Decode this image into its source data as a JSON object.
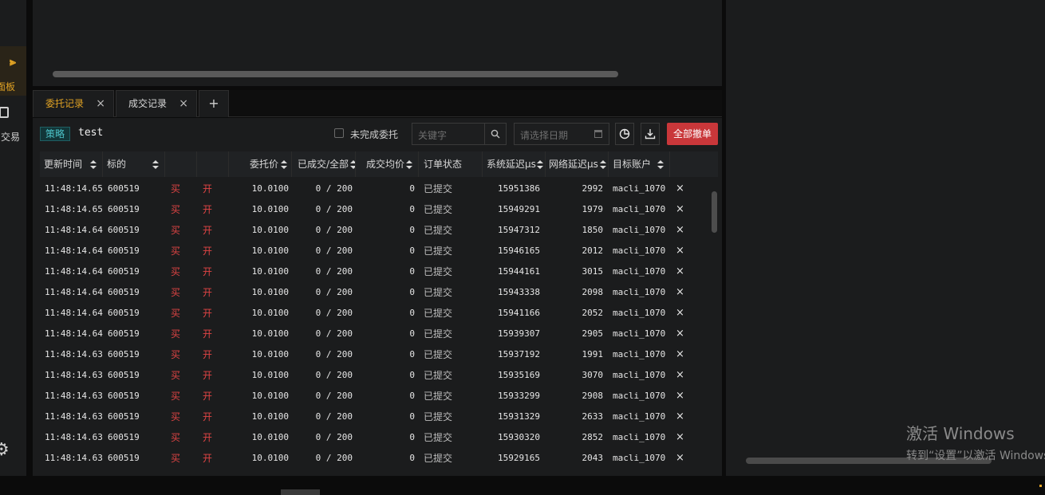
{
  "sidebar": {
    "active_label": "面板",
    "active_icon": "panel-icon",
    "trade_label": "交易",
    "trade_icon": "bag-icon",
    "settings_icon": "gear-icon"
  },
  "tabs": [
    {
      "label": "委托记录",
      "active": true
    },
    {
      "label": "成交记录",
      "active": false
    }
  ],
  "tab_close": "×",
  "tab_add": "+",
  "toolbar": {
    "strategy_tag": "策略",
    "strategy_name": "test",
    "unfinished_label": "未完成委托",
    "keyword_placeholder": "关键字",
    "date_placeholder": "请选择日期",
    "cancel_all_label": "全部撤单"
  },
  "columns": [
    "更新时间",
    "标的",
    "",
    "",
    "委托价",
    "已成交/全部",
    "成交均价",
    "订单状态",
    "系统延迟μs",
    "网络延迟μs",
    "目标账户",
    ""
  ],
  "rows": [
    {
      "time": "11:48:14.65",
      "symbol": "600519",
      "side": "买",
      "offset": "开",
      "price": "10.0100",
      "filled": "0 / 200",
      "avg": "0",
      "status": "已提交",
      "sys_latency": "15951386",
      "net_latency": "2992",
      "account": "macli_1070"
    },
    {
      "time": "11:48:14.65",
      "symbol": "600519",
      "side": "买",
      "offset": "开",
      "price": "10.0100",
      "filled": "0 / 200",
      "avg": "0",
      "status": "已提交",
      "sys_latency": "15949291",
      "net_latency": "1979",
      "account": "macli_1070"
    },
    {
      "time": "11:48:14.64",
      "symbol": "600519",
      "side": "买",
      "offset": "开",
      "price": "10.0100",
      "filled": "0 / 200",
      "avg": "0",
      "status": "已提交",
      "sys_latency": "15947312",
      "net_latency": "1850",
      "account": "macli_1070"
    },
    {
      "time": "11:48:14.64",
      "symbol": "600519",
      "side": "买",
      "offset": "开",
      "price": "10.0100",
      "filled": "0 / 200",
      "avg": "0",
      "status": "已提交",
      "sys_latency": "15946165",
      "net_latency": "2012",
      "account": "macli_1070"
    },
    {
      "time": "11:48:14.64",
      "symbol": "600519",
      "side": "买",
      "offset": "开",
      "price": "10.0100",
      "filled": "0 / 200",
      "avg": "0",
      "status": "已提交",
      "sys_latency": "15944161",
      "net_latency": "3015",
      "account": "macli_1070"
    },
    {
      "time": "11:48:14.64",
      "symbol": "600519",
      "side": "买",
      "offset": "开",
      "price": "10.0100",
      "filled": "0 / 200",
      "avg": "0",
      "status": "已提交",
      "sys_latency": "15943338",
      "net_latency": "2098",
      "account": "macli_1070"
    },
    {
      "time": "11:48:14.64",
      "symbol": "600519",
      "side": "买",
      "offset": "开",
      "price": "10.0100",
      "filled": "0 / 200",
      "avg": "0",
      "status": "已提交",
      "sys_latency": "15941166",
      "net_latency": "2052",
      "account": "macli_1070"
    },
    {
      "time": "11:48:14.64",
      "symbol": "600519",
      "side": "买",
      "offset": "开",
      "price": "10.0100",
      "filled": "0 / 200",
      "avg": "0",
      "status": "已提交",
      "sys_latency": "15939307",
      "net_latency": "2905",
      "account": "macli_1070"
    },
    {
      "time": "11:48:14.63",
      "symbol": "600519",
      "side": "买",
      "offset": "开",
      "price": "10.0100",
      "filled": "0 / 200",
      "avg": "0",
      "status": "已提交",
      "sys_latency": "15937192",
      "net_latency": "1991",
      "account": "macli_1070"
    },
    {
      "time": "11:48:14.63",
      "symbol": "600519",
      "side": "买",
      "offset": "开",
      "price": "10.0100",
      "filled": "0 / 200",
      "avg": "0",
      "status": "已提交",
      "sys_latency": "15935169",
      "net_latency": "3070",
      "account": "macli_1070"
    },
    {
      "time": "11:48:14.63",
      "symbol": "600519",
      "side": "买",
      "offset": "开",
      "price": "10.0100",
      "filled": "0 / 200",
      "avg": "0",
      "status": "已提交",
      "sys_latency": "15933299",
      "net_latency": "2908",
      "account": "macli_1070"
    },
    {
      "time": "11:48:14.63",
      "symbol": "600519",
      "side": "买",
      "offset": "开",
      "price": "10.0100",
      "filled": "0 / 200",
      "avg": "0",
      "status": "已提交",
      "sys_latency": "15931329",
      "net_latency": "2633",
      "account": "macli_1070"
    },
    {
      "time": "11:48:14.63",
      "symbol": "600519",
      "side": "买",
      "offset": "开",
      "price": "10.0100",
      "filled": "0 / 200",
      "avg": "0",
      "status": "已提交",
      "sys_latency": "15930320",
      "net_latency": "2852",
      "account": "macli_1070"
    },
    {
      "time": "11:48:14.63",
      "symbol": "600519",
      "side": "买",
      "offset": "开",
      "price": "10.0100",
      "filled": "0 / 200",
      "avg": "0",
      "status": "已提交",
      "sys_latency": "15929165",
      "net_latency": "2043",
      "account": "macli_1070"
    }
  ],
  "row_cancel": "×",
  "watermark": {
    "line1": "激活 Windows",
    "line2": "转到“设置”以激活 Windows"
  },
  "colors": {
    "accent": "#e0a224",
    "buy": "#e04444",
    "danger_button": "#c9373a",
    "strategy_tag": "#4cc3c8"
  }
}
